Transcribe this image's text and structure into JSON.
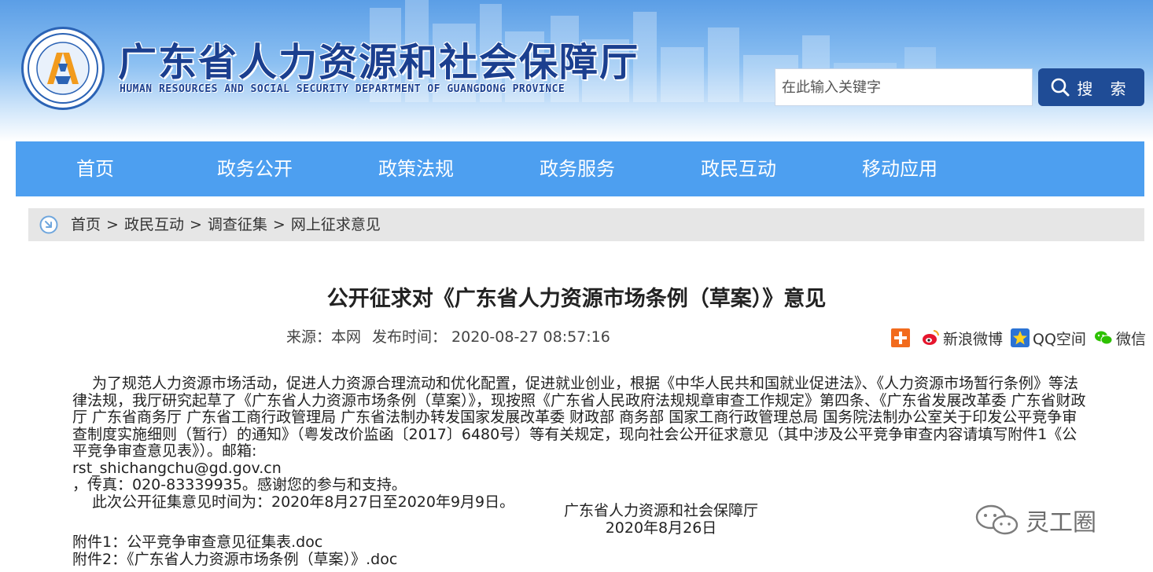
{
  "header": {
    "title": "广东省人力资源和社会保障厅",
    "subtitle": "HUMAN RESOURCES AND SOCIAL SECURITY DEPARTMENT OF GUANGDONG PROVINCE",
    "logo_icon": "seal-logo-icon",
    "search": {
      "placeholder": "在此输入关键字",
      "button_label": "搜 索",
      "icon": "search-icon"
    }
  },
  "nav": {
    "items": [
      "首页",
      "政务公开",
      "政策法规",
      "政务服务",
      "政民互动",
      "移动应用"
    ]
  },
  "breadcrumb": {
    "icon": "arrow-circle-icon",
    "items": [
      "首页",
      "政民互动",
      "调查征集",
      "网上征求意见"
    ],
    "separator": ">"
  },
  "article": {
    "title": "公开征求对《广东省人力资源市场条例（草案）》意见",
    "source": "来源：本网",
    "published": "发布时间： 2020-08-27 08:57:16",
    "share": {
      "plus_icon": "plus-icon",
      "weibo": "新浪微博",
      "qzone": "QQ空间",
      "wechat": "微信"
    },
    "paragraph1": "为了规范人力资源市场活动，促进人力资源合理流动和优化配置，促进就业创业，根据《中华人民共和国就业促进法》、《人力资源市场暂行条例》等法律法规，我厅研究起草了《广东省人力资源市场条例（草案）》，现按照《广东省人民政府法规规章审查工作规定》第四条、《广东省发展改革委 广东省财政厅 广东省商务厅 广东省工商行政管理局 广东省法制办转发国家发展改革委 财政部 商务部 国家工商行政管理总局 国务院法制办公室关于印发公平竞争审查制度实施细则（暂行）的通知》（粤发改价监函〔2017〕6480号）等有关规定，现向社会公开征求意见（其中涉及公平竞争审查内容请填写附件1《公平竞争审查意见表》）。邮箱:",
    "email": "rst_shichangchu@gd.gov.cn",
    "fax": "，传真：020-83339935。感谢您的参与和支持。",
    "paragraph2": "此次公开征集意见时间为：2020年8月27日至2020年9月9日。",
    "signature": "广东省人力资源和社会保障厅",
    "date": "2020年8月26日",
    "attachments": [
      "附件1：公平竞争审查意见征集表.doc",
      "附件2：《广东省人力资源市场条例（草案）》.doc"
    ]
  },
  "watermark": {
    "icon": "wechat-bubble-icon",
    "text": "灵工圈"
  },
  "colors": {
    "nav_bg": "#4d9ff0",
    "title_blue": "#1b3f8f",
    "search_button": "#1f4c96",
    "breadcrumb_bg": "#e6e6e6"
  }
}
